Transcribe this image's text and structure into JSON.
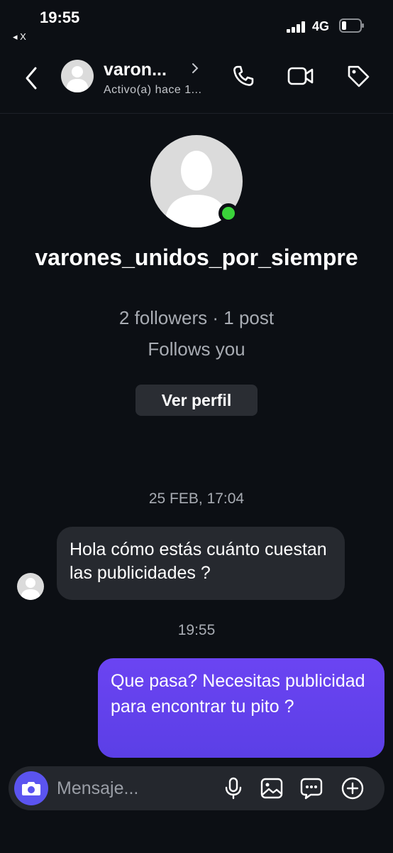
{
  "status_bar": {
    "time": "19:55",
    "back_app": "◂ X",
    "network": "4G"
  },
  "header": {
    "name": "varon...",
    "status": "Activo(a) hace 1...",
    "icons": [
      "back-chevron-icon",
      "phone-icon",
      "video-camera-icon",
      "tag-icon"
    ]
  },
  "profile": {
    "username": "varones_unidos_por_siempre",
    "stats": "2 followers · 1 post",
    "follows": "Follows you",
    "view_profile_label": "Ver perfil"
  },
  "chat": {
    "timestamp_1": "25 FEB, 17:04",
    "incoming_message": "Hola cómo estás cuánto cuestan las publicidades ?",
    "timestamp_2": "19:55",
    "outgoing_message": "Que pasa? Necesitas publicidad para encontrar tu pito ?"
  },
  "composer": {
    "placeholder": "Mensaje...",
    "icons": [
      "camera-icon",
      "microphone-icon",
      "image-icon",
      "sticker-chat-icon",
      "add-icon"
    ]
  },
  "colors": {
    "background": "#0c0f14",
    "outgoing_bubble": "#5b3fe6",
    "incoming_bubble": "#26292f",
    "online": "#3ad33a",
    "camera_button": "#5b54f0"
  }
}
